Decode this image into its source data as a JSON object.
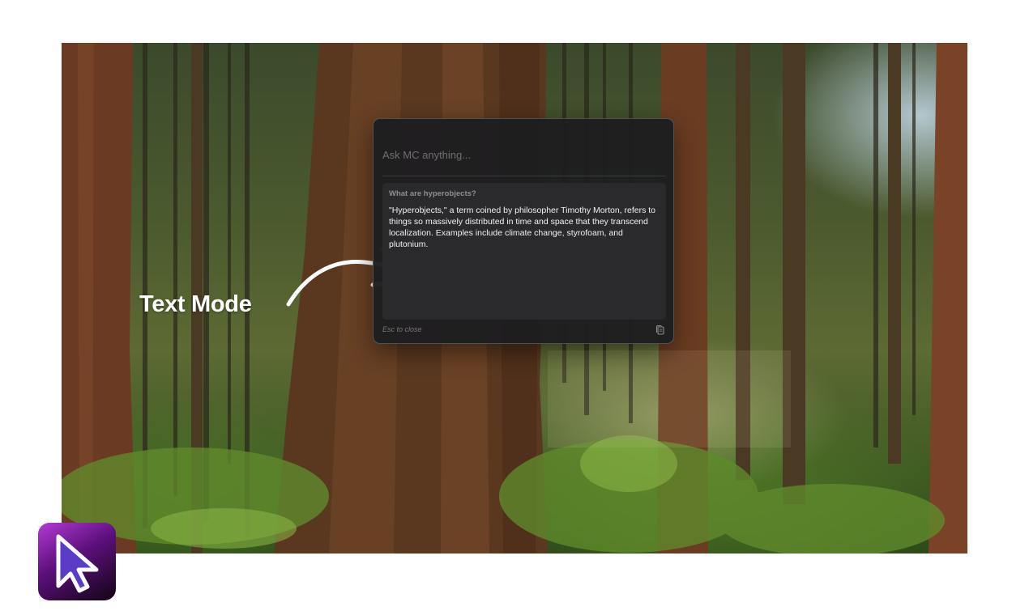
{
  "dialog": {
    "input_placeholder": "Ask MC anything...",
    "input_value": "",
    "question": "What are hyperobjects?",
    "answer": "\"Hyperobjects,\" a term coined by philosopher Timothy Morton, refers to things so massively distributed in time and space that they transcend localization. Examples include climate change, styrofoam, and plutonium.",
    "close_hint": "Esc to close",
    "copy_icon": "copy-icon"
  },
  "annotation": {
    "label": "Text Mode",
    "arrow_icon": "curved-arrow-icon"
  },
  "app_icon": {
    "icon": "cursor-arrow-icon",
    "colors": {
      "gradient_start": "#b23ad6",
      "gradient_end": "#120412",
      "cursor_fill": "#5a3cc8",
      "cursor_stroke": "#ffffff"
    }
  },
  "colors": {
    "dialog_bg": "#1e1e20",
    "panel_bg": "#2a2a2c",
    "answer_text": "#f2f2f2",
    "question_text": "#8e8e92"
  }
}
